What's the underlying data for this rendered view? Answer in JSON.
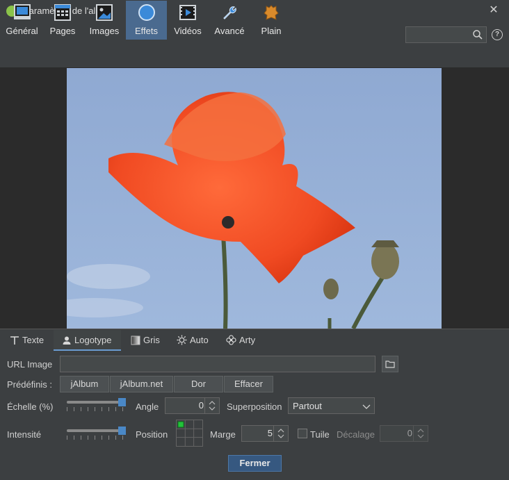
{
  "window": {
    "title": "Paramètres de l'album",
    "close_icon": "close-icon"
  },
  "toolbar": {
    "items": [
      {
        "label": "Général",
        "icon": "monitor-icon"
      },
      {
        "label": "Pages",
        "icon": "grid-icon"
      },
      {
        "label": "Images",
        "icon": "image-icon"
      },
      {
        "label": "Effets",
        "icon": "circle-effect-icon"
      },
      {
        "label": "Vidéos",
        "icon": "film-icon"
      },
      {
        "label": "Avancé",
        "icon": "wrench-icon"
      },
      {
        "label": "Plain",
        "icon": "leather-icon"
      }
    ],
    "active": "Effets",
    "search_value": "",
    "search_icon": "search-icon",
    "help_icon": "help-icon"
  },
  "tabs": [
    {
      "label": "Texte",
      "icon": "text-icon"
    },
    {
      "label": "Logotype",
      "icon": "user-icon"
    },
    {
      "label": "Gris",
      "icon": "gradient-icon"
    },
    {
      "label": "Auto",
      "icon": "sun-icon"
    },
    {
      "label": "Arty",
      "icon": "flower-icon"
    }
  ],
  "active_tab": "Logotype",
  "form": {
    "url_label": "URL Image",
    "url_value": "",
    "presets_label": "Prédéfinis :",
    "presets": [
      "jAlbum",
      "jAlbum.net",
      "Dor",
      "Effacer"
    ],
    "scale_label": "Échelle (%)",
    "scale_level": 1.0,
    "angle_label": "Angle",
    "angle_value": "0",
    "overlay_label": "Superposition",
    "overlay_value": "Partout",
    "intensity_label": "Intensité",
    "intensity_level": 1.0,
    "position_label": "Position",
    "margin_label": "Marge",
    "margin_value": "5",
    "tile_label": "Tuile",
    "tile_checked": false,
    "offset_label": "Décalage",
    "offset_value": "0",
    "close_button": "Fermer"
  },
  "colors": {
    "accent": "#4a88c7",
    "active_tool": "#4a6a8f",
    "primary_button": "#365880"
  }
}
